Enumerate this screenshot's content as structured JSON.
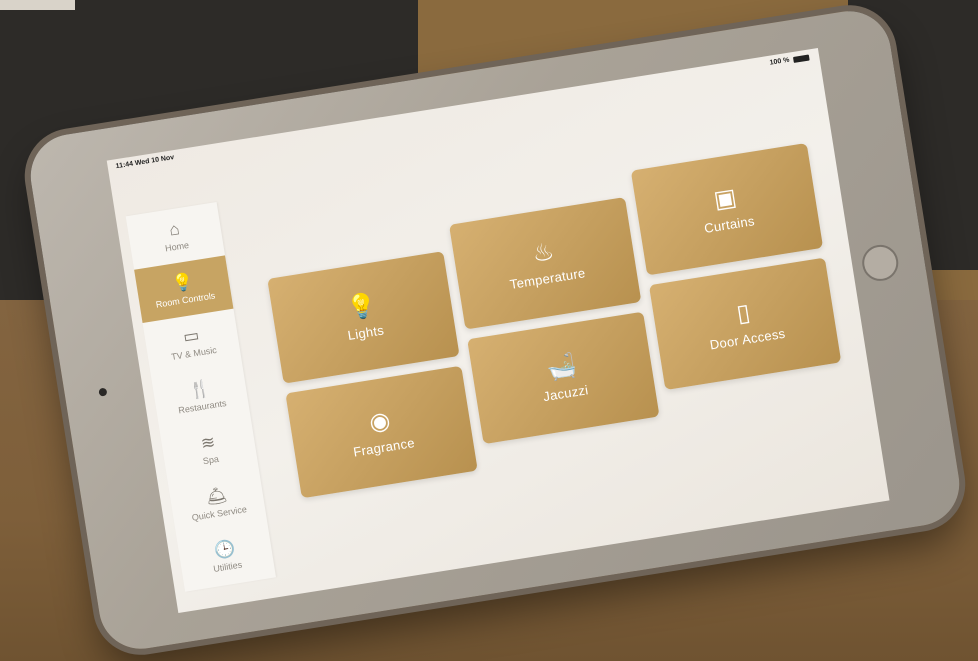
{
  "status_bar": {
    "time": "11:44",
    "date": "Wed 10 Nov",
    "battery": "100 %"
  },
  "sidebar": {
    "items": [
      {
        "label": "Home",
        "icon": "home-icon",
        "glyph": "⌂",
        "active": false
      },
      {
        "label": "Room Controls",
        "icon": "lightbulb-icon",
        "glyph": "💡",
        "active": true
      },
      {
        "label": "TV & Music",
        "icon": "tv-icon",
        "glyph": "▭",
        "active": false
      },
      {
        "label": "Restaurants",
        "icon": "cutlery-icon",
        "glyph": "🍴",
        "active": false
      },
      {
        "label": "Spa",
        "icon": "spa-stones-icon",
        "glyph": "≋",
        "active": false
      },
      {
        "label": "Quick Service",
        "icon": "service-bell-icon",
        "glyph": "🛎",
        "active": false
      },
      {
        "label": "Utilities",
        "icon": "clock-icon",
        "glyph": "🕒",
        "active": false
      }
    ]
  },
  "tiles": [
    {
      "label": "Lights",
      "icon": "lightbulb-icon",
      "glyph": "💡"
    },
    {
      "label": "Temperature",
      "icon": "heater-icon",
      "glyph": "♨"
    },
    {
      "label": "Curtains",
      "icon": "curtains-icon",
      "glyph": "▣"
    },
    {
      "label": "Fragrance",
      "icon": "fragrance-icon",
      "glyph": "◉"
    },
    {
      "label": "Jacuzzi",
      "icon": "bathtub-icon",
      "glyph": "🛁"
    },
    {
      "label": "Door Access",
      "icon": "door-icon",
      "glyph": "▯"
    }
  ],
  "colors": {
    "accent": "#c7a463",
    "tile": "#c9a25f",
    "sidebar_text": "#8f8a82"
  }
}
